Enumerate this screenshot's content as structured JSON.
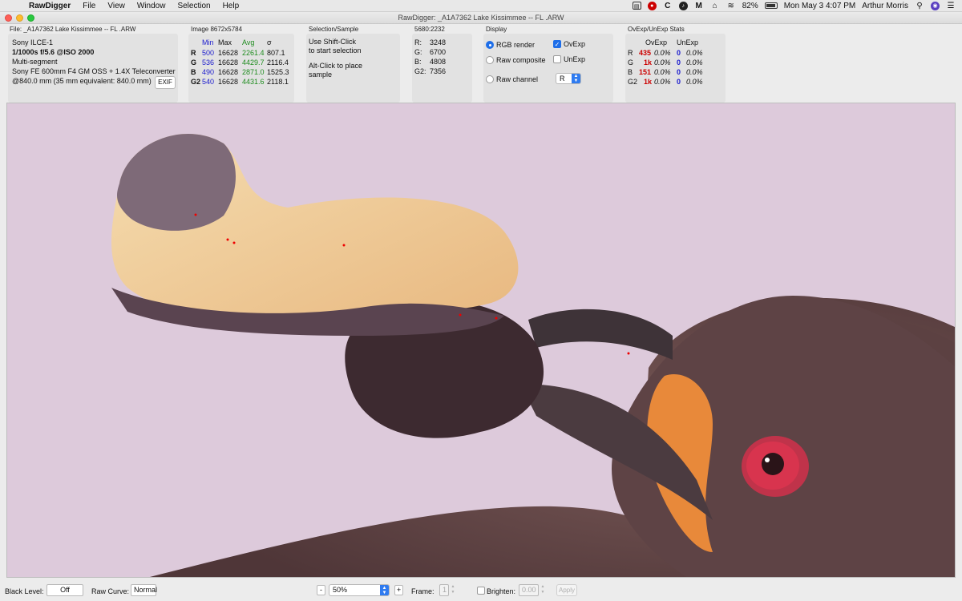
{
  "menubar": {
    "app": "RawDigger",
    "menus": [
      "File",
      "View",
      "Window",
      "Selection",
      "Help"
    ],
    "battery": "82%",
    "datetime": "Mon May 3  4:07 PM",
    "user": "Arthur Morris"
  },
  "window": {
    "title": "RawDigger: _A1A7362 Lake Kissimmee -- FL .ARW"
  },
  "file_panel": {
    "label": "File: _A1A7362 Lake Kissimmee -- FL .ARW",
    "camera": "Sony ILCE-1",
    "exposure": "1/1000s f/5.6 @ISO 2000",
    "metering": "Multi-segment",
    "lens": "Sony FE 600mm F4 GM OSS + 1.4X Teleconverter",
    "focal": "@840.0 mm (35 mm equivalent: 840.0 mm)",
    "exif_button": "EXIF"
  },
  "image_panel": {
    "label": "Image 8672x5784",
    "headers": [
      "Min",
      "Max",
      "Avg",
      "σ"
    ],
    "rows": [
      {
        "ch": "R",
        "min": "500",
        "max": "16628",
        "avg": "2261.4",
        "sigma": "807.1"
      },
      {
        "ch": "G",
        "min": "536",
        "max": "16628",
        "avg": "4429.7",
        "sigma": "2116.4"
      },
      {
        "ch": "B",
        "min": "490",
        "max": "16628",
        "avg": "2871.0",
        "sigma": "1525.3"
      },
      {
        "ch": "G2",
        "min": "540",
        "max": "16628",
        "avg": "4431.6",
        "sigma": "2118.1"
      }
    ]
  },
  "selection_panel": {
    "label": "Selection/Sample",
    "line1": "Use Shift-Click",
    "line2": "to start selection",
    "line3": "Alt-Click to place",
    "line4": "sample"
  },
  "sample_panel": {
    "label": "5680:2232",
    "rows": [
      {
        "ch": "R:",
        "val": "3248"
      },
      {
        "ch": "G:",
        "val": "6700"
      },
      {
        "ch": "B:",
        "val": "4808"
      },
      {
        "ch": "G2:",
        "val": "7356"
      }
    ]
  },
  "display_panel": {
    "label": "Display",
    "rgb_render": "RGB render",
    "raw_composite": "Raw composite",
    "raw_channel": "Raw channel",
    "ovexp": "OvExp",
    "unexp": "UnExp",
    "channel_value": "R"
  },
  "stats_panel": {
    "label": "OvExp/UnExp Stats",
    "headers": [
      "OvExp",
      "UnExp"
    ],
    "rows": [
      {
        "ch": "R",
        "ov_count": "435",
        "ov_pct": "0.0%",
        "un_count": "0",
        "un_pct": "0.0%"
      },
      {
        "ch": "G",
        "ov_count": "1k",
        "ov_pct": "0.0%",
        "un_count": "0",
        "un_pct": "0.0%"
      },
      {
        "ch": "B",
        "ov_count": "151",
        "ov_pct": "0.0%",
        "un_count": "0",
        "un_pct": "0.0%"
      },
      {
        "ch": "G2",
        "ov_count": "1k",
        "ov_pct": "0.0%",
        "un_count": "0",
        "un_pct": "0.0%"
      }
    ]
  },
  "bottom": {
    "black_level_label": "Black Level:",
    "black_level_value": "Off",
    "raw_curve_label": "Raw Curve:",
    "raw_curve_value": "Normal",
    "minus": "-",
    "zoom": "50%",
    "plus": "+",
    "frame_label": "Frame:",
    "frame_value": "1",
    "brighten_label": "Brighten:",
    "brighten_value": "0.00",
    "apply": "Apply"
  },
  "colors": {
    "background_photo": "#ddcadb",
    "min_blue": "#1a1acd",
    "avg_green": "#1e8c1e",
    "ovexp_red": "#cc0000",
    "accent": "#1e6ee8"
  }
}
